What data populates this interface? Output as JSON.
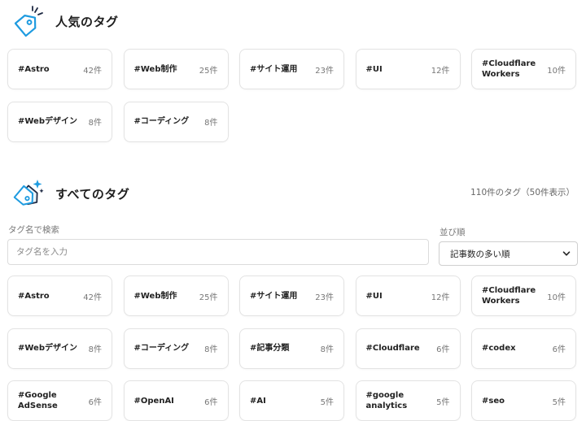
{
  "popular": {
    "title": "人気のタグ",
    "icon": "tag-icon",
    "tags": [
      {
        "name": "#Astro",
        "count": "42件"
      },
      {
        "name": "#Web制作",
        "count": "25件"
      },
      {
        "name": "#サイト運用",
        "count": "23件"
      },
      {
        "name": "#UI",
        "count": "12件"
      },
      {
        "name": "#Cloudflare Workers",
        "count": "10件"
      },
      {
        "name": "#Webデザイン",
        "count": "8件"
      },
      {
        "name": "#コーディング",
        "count": "8件"
      }
    ]
  },
  "all": {
    "title": "すべてのタグ",
    "icon": "tags-sparkle-icon",
    "summary": "110件のタグ（50件表示）",
    "search": {
      "label": "タグ名で検索",
      "placeholder": "タグ名を入力",
      "value": ""
    },
    "sort": {
      "label": "並び順",
      "selected": "記事数の多い順",
      "icon": "chevron-down-icon"
    },
    "tags": [
      {
        "name": "#Astro",
        "count": "42件"
      },
      {
        "name": "#Web制作",
        "count": "25件"
      },
      {
        "name": "#サイト運用",
        "count": "23件"
      },
      {
        "name": "#UI",
        "count": "12件"
      },
      {
        "name": "#Cloudflare Workers",
        "count": "10件"
      },
      {
        "name": "#Webデザイン",
        "count": "8件"
      },
      {
        "name": "#コーディング",
        "count": "8件"
      },
      {
        "name": "#記事分類",
        "count": "8件"
      },
      {
        "name": "#Cloudflare",
        "count": "6件"
      },
      {
        "name": "#codex",
        "count": "6件"
      },
      {
        "name": "#Google AdSense",
        "count": "6件"
      },
      {
        "name": "#OpenAI",
        "count": "6件"
      },
      {
        "name": "#AI",
        "count": "5件"
      },
      {
        "name": "#google analytics",
        "count": "5件"
      },
      {
        "name": "#seo",
        "count": "5件"
      }
    ]
  },
  "colors": {
    "accent": "#1e9be0",
    "icon_dark": "#1f2a44",
    "border": "#e3e3e3"
  }
}
